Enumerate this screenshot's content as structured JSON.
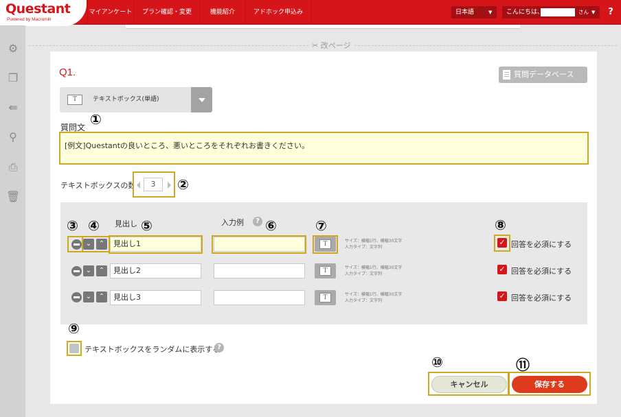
{
  "header": {
    "logo_main": "Questant",
    "logo_sub": "Powered by Macromill",
    "nav": [
      "マイアンケート",
      "プラン確認・変更",
      "機能紹介",
      "アドホック申込み"
    ],
    "language": "日本語",
    "greeting": "こんにちは、",
    "user_suffix": "さん",
    "help": "?"
  },
  "page_break": "✂ 改ページ",
  "question": {
    "number": "Q1.",
    "database_button": "質問データベース",
    "type_label": "テキストボックス(単語)",
    "type_icon": "T",
    "text_label": "質問文",
    "text_value": "[例文]Questantの良いところ、悪いところをそれぞれお書きください。",
    "count_label": "テキストボックスの数",
    "count_value": "3"
  },
  "rows_header": {
    "heading": "見出し",
    "example": "入力例",
    "help": "?"
  },
  "rows": [
    {
      "heading": "見出し1",
      "example": "",
      "info1": "サイズ：横幅1行、横幅30文字",
      "info2": "入力タイプ：文字列",
      "required_label": "回答を必須にする",
      "required": true
    },
    {
      "heading": "見出し2",
      "example": "",
      "info1": "サイズ：横幅1行、横幅30文字",
      "info2": "入力タイプ：文字列",
      "required_label": "回答を必須にする",
      "required": true
    },
    {
      "heading": "見出し3",
      "example": "",
      "info1": "サイズ：横幅1行、横幅30文字",
      "info2": "入力タイプ：文字列",
      "required_label": "回答を必須にする",
      "required": true
    }
  ],
  "random": {
    "label": "テキストボックスをランダムに表示する",
    "help": "?",
    "checked": false
  },
  "buttons": {
    "cancel": "キャンセル",
    "save": "保存する"
  },
  "callouts": [
    "①",
    "②",
    "③",
    "④",
    "⑤",
    "⑥",
    "⑦",
    "⑧",
    "⑨",
    "⑩",
    "⑪"
  ],
  "colors": {
    "brand_red": "#d6151b",
    "highlight": "#d0a81f",
    "save_red": "#dd3b1c"
  },
  "icons": {
    "sidebar": [
      "gear-icon",
      "copy-icon",
      "import-icon",
      "search-icon",
      "print-icon",
      "trash-icon"
    ]
  }
}
